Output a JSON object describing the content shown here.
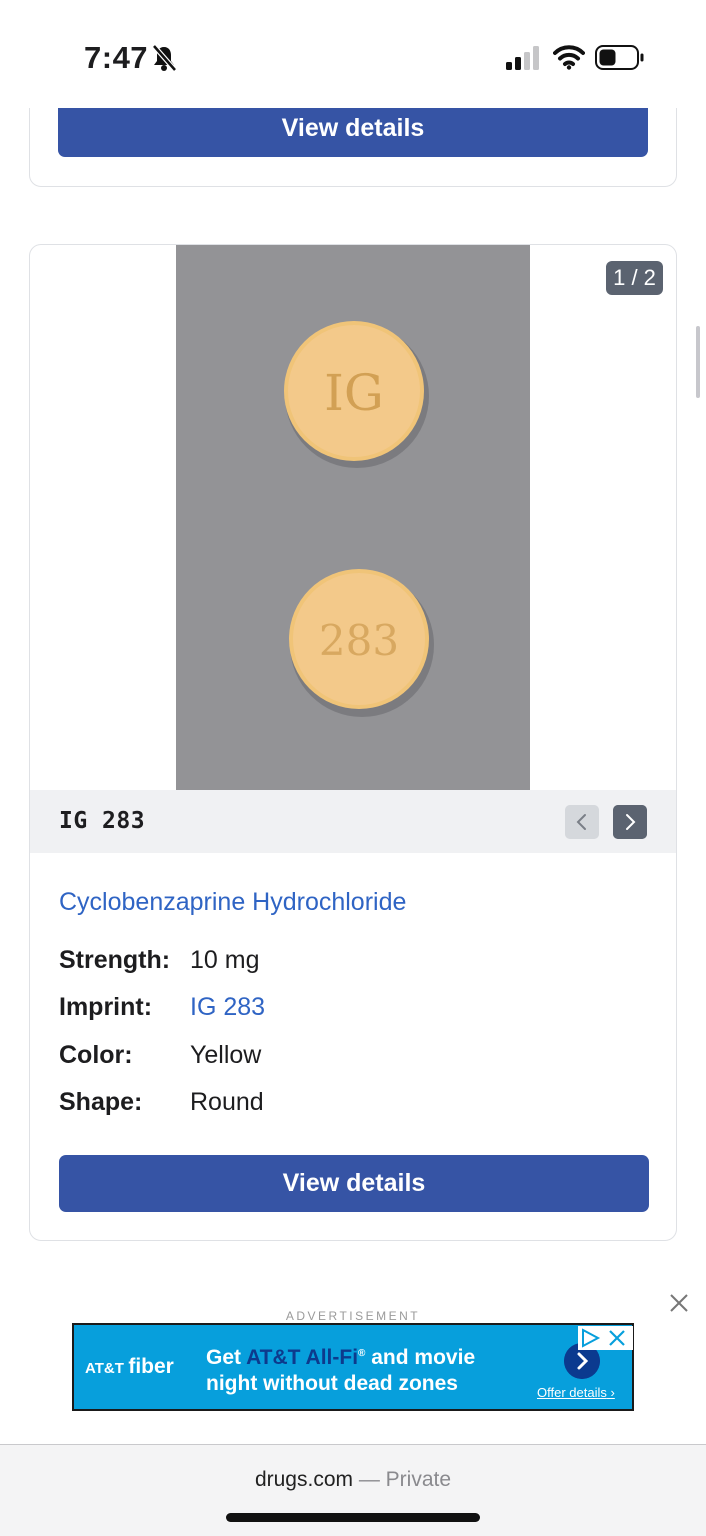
{
  "status_bar": {
    "time": "7:47"
  },
  "top_card": {
    "button_label": "View details"
  },
  "pill_card": {
    "image_counter": "1 / 2",
    "pill_imprints": [
      "IG",
      "283"
    ],
    "imprint_code": "IG 283",
    "drug_name": "Cyclobenzaprine Hydrochloride",
    "details": [
      {
        "label": "Strength:",
        "value": "10 mg",
        "is_link": false
      },
      {
        "label": "Imprint:",
        "value": "IG 283",
        "is_link": true
      },
      {
        "label": "Color:",
        "value": "Yellow",
        "is_link": false
      },
      {
        "label": "Shape:",
        "value": "Round",
        "is_link": false
      }
    ],
    "button_label": "View details"
  },
  "advertisement": {
    "label": "ADVERTISEMENT",
    "brand_att": "AT&T",
    "brand_fiber": "fiber",
    "line1_pre": "Get ",
    "line1_highlight": "AT&T All-Fi",
    "line1_post": " and movie",
    "line2": "night without dead zones",
    "offer_link": "Offer details"
  },
  "browser": {
    "domain": "drugs.com",
    "mode": " — Private"
  },
  "colors": {
    "button": "#3654a5",
    "link": "#2f64c4",
    "ad_bg": "#079fdc"
  }
}
